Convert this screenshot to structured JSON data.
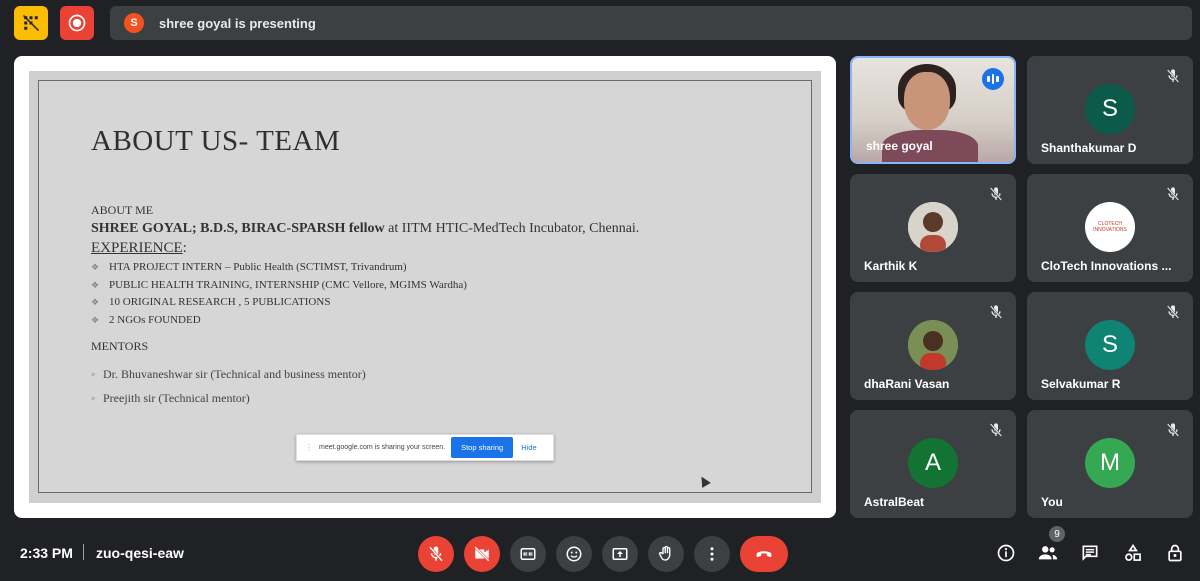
{
  "top_bar": {
    "presenting_initial": "S",
    "presenting_text": "shree goyal is presenting"
  },
  "slide": {
    "title": "ABOUT US- TEAM",
    "about_label": "ABOUT ME",
    "name_bold": "SHREE GOYAL; B.D.S, BIRAC-SPARSH fellow",
    "name_rest": " at IITM HTIC-MedTech Incubator, Chennai.",
    "experience_heading": "EXPERIENCE",
    "experience_colon": ":",
    "experience_items": [
      "HTA PROJECT INTERN – Public Health (SCTIMST, Trivandrum)",
      "PUBLIC HEALTH TRAINING, INTERNSHIP (CMC Vellore, MGIMS Wardha)",
      "10 ORIGINAL RESEARCH , 5 PUBLICATIONS",
      "2 NGOs FOUNDED"
    ],
    "mentors_label": "MENTORS",
    "mentors": [
      "Dr. Bhuvaneshwar sir (Technical and business mentor)",
      "Preejith sir (Technical mentor)"
    ],
    "share_popup": {
      "text": "meet.google.com is sharing your screen.",
      "stop_label": "Stop sharing",
      "hide_label": "Hide"
    }
  },
  "participants": [
    {
      "name": "shree goyal",
      "type": "video",
      "speaking": true
    },
    {
      "name": "Shanthakumar D",
      "initial": "S",
      "color": "#0b5a4a",
      "muted": true
    },
    {
      "name": "Karthik K",
      "type": "photo",
      "muted": true
    },
    {
      "name": "CloTech Innovations ...",
      "logo_text": "CLOTECH INNOVATIONS",
      "muted": true
    },
    {
      "name": "dhaRani Vasan",
      "type": "photo",
      "muted": true
    },
    {
      "name": "Selvakumar R",
      "initial": "S",
      "color": "#0f8474",
      "muted": true
    },
    {
      "name": "AstralBeat",
      "initial": "A",
      "color": "#137333",
      "muted": true
    },
    {
      "name": "You",
      "initial": "M",
      "color": "#34a853",
      "muted": true
    }
  ],
  "bottom_bar": {
    "time": "2:33 PM",
    "meeting_code": "zuo-qesi-eaw",
    "people_count": "9"
  },
  "colors": {
    "background": "#202124",
    "tile": "#3c4043",
    "red": "#ea4335",
    "yellow": "#fbbc04",
    "blue": "#1a73e8"
  }
}
